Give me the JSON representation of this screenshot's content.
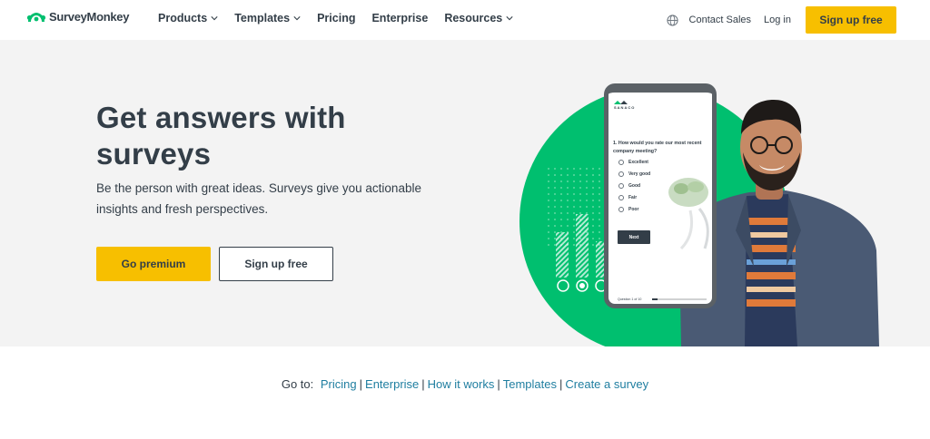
{
  "nav": {
    "logo_text": "SurveyMonkey",
    "menu": [
      {
        "label": "Products",
        "dropdown": true
      },
      {
        "label": "Templates",
        "dropdown": true
      },
      {
        "label": "Pricing",
        "dropdown": false
      },
      {
        "label": "Enterprise",
        "dropdown": false
      },
      {
        "label": "Resources",
        "dropdown": true
      }
    ],
    "contact_sales": "Contact Sales",
    "login": "Log in",
    "signup": "Sign up free"
  },
  "hero": {
    "title": "Get answers with surveys",
    "subtitle": "Be the person with great ideas. Surveys give you actionable insights and fresh perspectives.",
    "primary_button": "Go premium",
    "secondary_button": "Sign up free"
  },
  "phone": {
    "brand": "SANACO",
    "question": "1. How would you rate our most recent company meeting?",
    "options": [
      "Excellent",
      "Very good",
      "Good",
      "Fair",
      "Poor"
    ],
    "next_label": "Next",
    "progress_label": "Question 1 of 10",
    "progress_fraction": 0.1
  },
  "goto": {
    "prefix": "Go to:",
    "links": [
      "Pricing",
      "Enterprise",
      "How it works",
      "Templates",
      "Create a survey"
    ]
  },
  "colors": {
    "brand_green": "#00bf6f",
    "accent_yellow": "#f7bf00",
    "text_dark": "#333e48",
    "link_teal": "#1f7ea0",
    "hero_bg": "#f3f3f3"
  }
}
